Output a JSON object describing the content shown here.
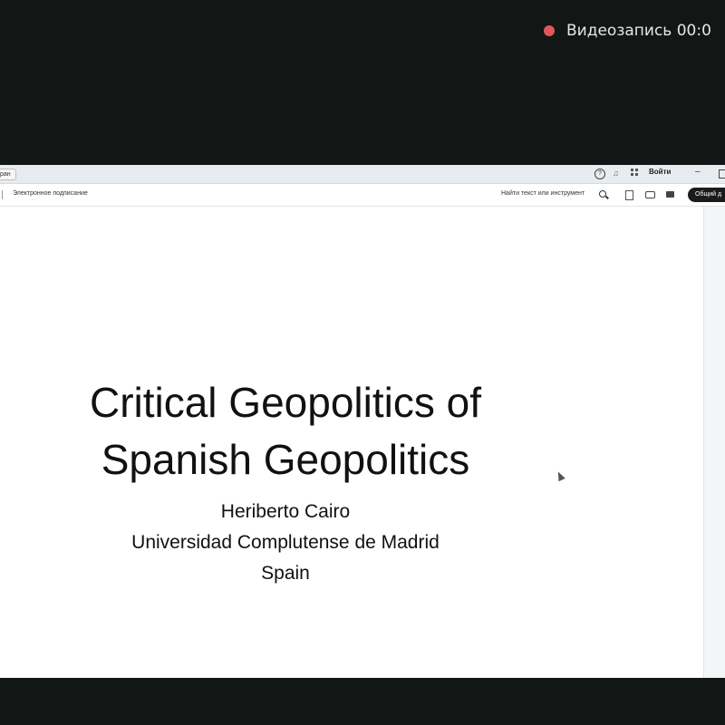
{
  "recording": {
    "label": "Видеозапись 00:0"
  },
  "window": {
    "tab_label": "ран",
    "login_label": "Войти",
    "minimize_glyph": "–"
  },
  "toolbar": {
    "sign_label": "Электронное подписание",
    "search_placeholder": "Найти текст или инструмент",
    "share_label": "Общий д"
  },
  "slide": {
    "title_line1": "Critical Geopolitics of",
    "title_line2": "Spanish Geopolitics",
    "author": "Heriberto Cairo",
    "affiliation": "Universidad Complutense de Madrid",
    "country": "Spain"
  },
  "colors": {
    "background": "#121614",
    "record_dot": "#e0565a",
    "share_button": "#1b1b1b"
  }
}
